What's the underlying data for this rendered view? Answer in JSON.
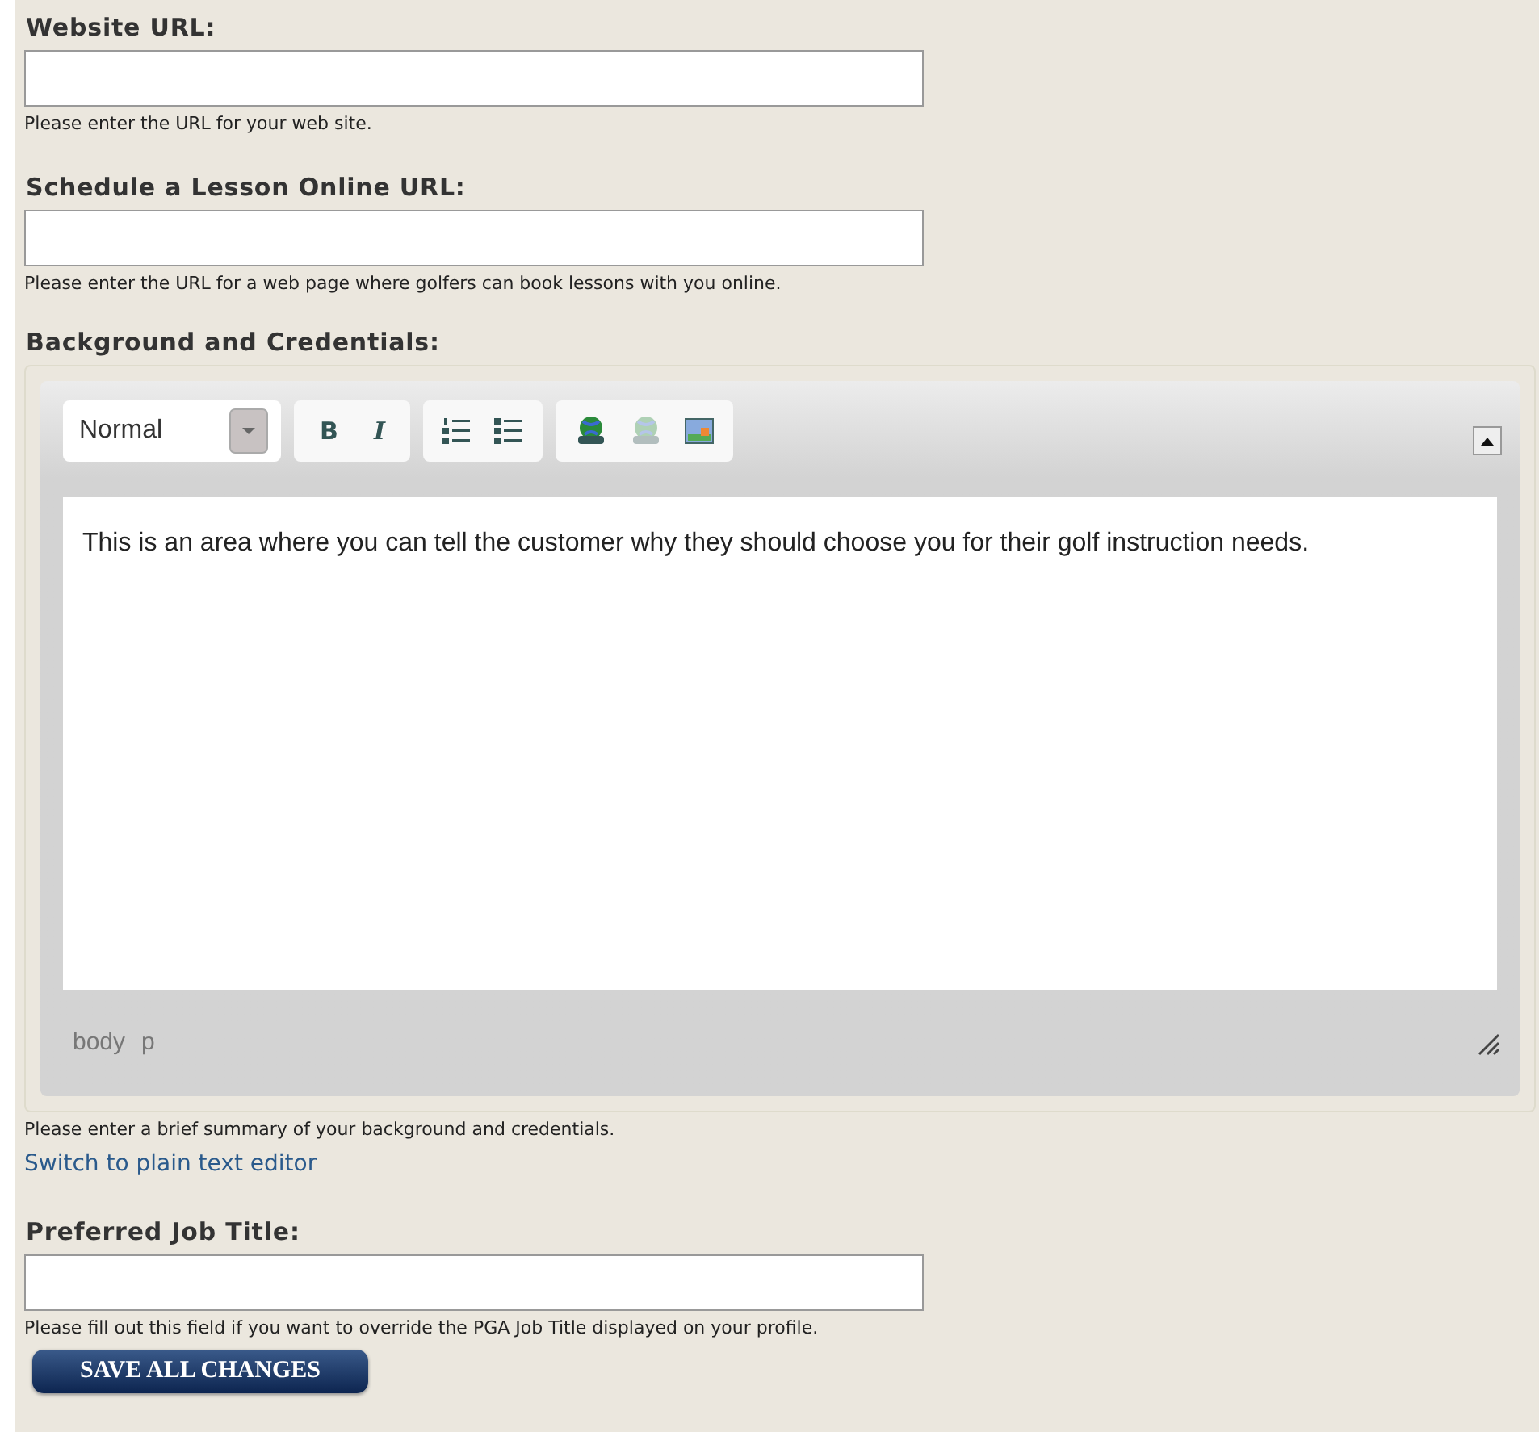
{
  "fields": [
    {
      "kind": "text",
      "label": "Website URL:",
      "hint": "Please enter the URL for your web site."
    },
    {
      "kind": "text",
      "label": "Schedule a Lesson Online URL:",
      "hint": "Please enter the URL for a web page where golfers can book lessons with you online."
    },
    {
      "kind": "editor",
      "label": "Background and Credentials:",
      "format": "Normal",
      "tools": [
        {
          "kind": "bold",
          "label": "B",
          "disabled": false
        },
        {
          "kind": "italic",
          "label": "I",
          "disabled": false
        },
        {
          "kind": "ordered-list",
          "disabled": false
        },
        {
          "kind": "bullet-list",
          "disabled": false
        },
        {
          "kind": "link",
          "disabled": false
        },
        {
          "kind": "unlink",
          "disabled": true
        },
        {
          "kind": "image",
          "disabled": false
        }
      ],
      "content": "This is an area where you can tell the customer why they should choose you for their golf instruction needs.",
      "path": [
        "body",
        "p"
      ],
      "hint": "Please enter a brief summary of your background and credentials.",
      "link": "Switch to plain text editor"
    },
    {
      "kind": "text",
      "label": "Preferred Job Title:",
      "hint": "Please fill out this field if you want to override the PGA Job Title displayed on your profile."
    }
  ],
  "save_button": "SAVE ALL CHANGES"
}
